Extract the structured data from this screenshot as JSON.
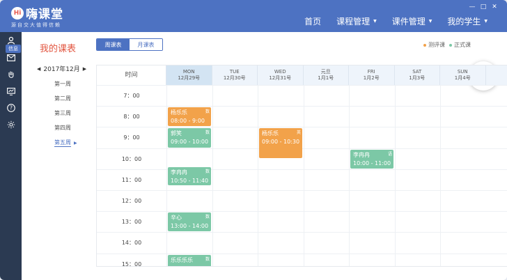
{
  "header": {
    "logo_badge": "Hi",
    "logo_text": "嗨课堂",
    "slogan": "源自交大值得信赖",
    "nav": [
      {
        "label": "首页",
        "has_caret": false
      },
      {
        "label": "课程管理",
        "has_caret": true
      },
      {
        "label": "课件管理",
        "has_caret": true
      },
      {
        "label": "我的学生",
        "has_caret": true
      }
    ],
    "window_controls": [
      "—",
      "□",
      "✕"
    ]
  },
  "sidebar": {
    "items": [
      "user-icon",
      "message-icon",
      "hand-icon",
      "screen-icon",
      "help-icon",
      "settings-icon"
    ],
    "tooltip": "信息"
  },
  "main": {
    "title": "我的课表",
    "tabs": [
      {
        "label": "周课表",
        "active": true
      },
      {
        "label": "月课表",
        "active": false
      }
    ],
    "legend": [
      {
        "label": "测评课",
        "color": "#f2a24a"
      },
      {
        "label": "正式课",
        "color": "#7cc8a6"
      }
    ],
    "month": "2017年12月",
    "weeks": [
      {
        "label": "第一周",
        "active": false
      },
      {
        "label": "第二周",
        "active": false
      },
      {
        "label": "第三周",
        "active": false
      },
      {
        "label": "第四周",
        "active": false
      },
      {
        "label": "第五周",
        "active": true
      }
    ]
  },
  "calendar": {
    "time_header": "时间",
    "days": [
      {
        "top": "MON",
        "date": "12月29号"
      },
      {
        "top": "TUE",
        "date": "12月30号"
      },
      {
        "top": "WED",
        "date": "12月31号"
      },
      {
        "top": "元旦",
        "date": "1月1号"
      },
      {
        "top": "FRI",
        "date": "1月2号"
      },
      {
        "top": "SAT",
        "date": "1月3号"
      },
      {
        "top": "SUN",
        "date": "1月4号"
      }
    ],
    "times": [
      "7：00",
      "8：00",
      "9：00",
      "10：00",
      "11：00",
      "12：00",
      "13：00",
      "14：00",
      "15：00"
    ],
    "events": [
      {
        "day": 0,
        "start_hour": 8.0,
        "name": "杨乐乐",
        "time": "08:00 - 9:00",
        "tag": "数",
        "type": "测评课",
        "color": "#f2a24a"
      },
      {
        "day": 0,
        "start_hour": 9.0,
        "name": "郭笑",
        "time": "09:00 - 10:00",
        "tag": "数",
        "type": "正式课",
        "color": "#7cc8a6"
      },
      {
        "day": 2,
        "start_hour": 9.0,
        "name": "杨乐乐",
        "time": "09:00 - 10:30",
        "tag": "英",
        "type": "测评课",
        "color": "#f2a24a"
      },
      {
        "day": 4,
        "start_hour": 10.0,
        "name": "李冉冉",
        "time": "10:00 - 11:00",
        "tag": "语",
        "type": "正式课",
        "color": "#7cc8a6"
      },
      {
        "day": 0,
        "start_hour": 10.83,
        "name": "李冉冉",
        "time": "10:50 - 11:40",
        "tag": "数",
        "type": "正式课",
        "color": "#7cc8a6"
      },
      {
        "day": 0,
        "start_hour": 13.0,
        "name": "辛心",
        "time": "13:00 - 14:00",
        "tag": "数",
        "type": "正式课",
        "color": "#7cc8a6"
      },
      {
        "day": 0,
        "start_hour": 15.0,
        "name": "乐乐乐乐",
        "time": "",
        "tag": "数",
        "type": "正式课",
        "color": "#7cc8a6"
      }
    ]
  }
}
